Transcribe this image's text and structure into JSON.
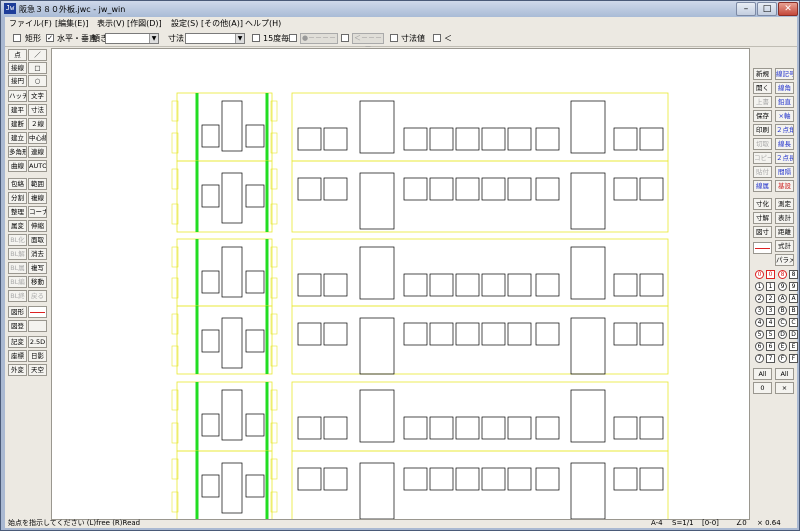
{
  "window": {
    "title": "阪急３８０外板.jwc - jw_win",
    "app_icon": "Jw"
  },
  "menu": [
    "ファイル(F)",
    "[編集(E)]",
    "表示(V)",
    "[作図(D)]",
    "設定(S)",
    "[その他(A)]",
    "ヘルプ(H)"
  ],
  "toolbar": {
    "rect_label": "矩形",
    "hv_label": "水平・垂直",
    "tilt_label": "傾き",
    "dim_label": "寸法",
    "deg15_label": "15度毎",
    "dimval_label": "寸法値",
    "gray1": "●－－－－",
    "gray2": "＜－－－－",
    "lt_label": "＜"
  },
  "left_tools": [
    [
      "点",
      "／"
    ],
    [
      "接線",
      "□"
    ],
    [
      "接円",
      "○"
    ],
    [
      "ハッチ",
      "文字"
    ],
    [
      "建平",
      "寸法"
    ],
    [
      "建断",
      "２線"
    ],
    [
      "建立",
      "中心線"
    ],
    [
      "多角形",
      "連線"
    ],
    [
      "曲線",
      "AUTO"
    ],
    [
      "包絡",
      "範囲"
    ],
    [
      "分割",
      "複線"
    ],
    [
      "整理",
      "コーナー"
    ],
    [
      "属変",
      "伸縮"
    ],
    [
      "BL化",
      "面取"
    ],
    [
      "BL解",
      "消去"
    ],
    [
      "BL属",
      "複写"
    ],
    [
      "BL編",
      "移動"
    ],
    [
      "BL終",
      "戻る"
    ],
    [
      "図形",
      ""
    ],
    [
      "図登",
      ""
    ],
    [
      "記変",
      "2.5D"
    ],
    [
      "座標",
      "日影"
    ],
    [
      "外変",
      "天空"
    ]
  ],
  "right_tools": [
    [
      "新規",
      "線記号変形"
    ],
    [
      "開く",
      "線角"
    ],
    [
      "上書",
      "鉛直"
    ],
    [
      "保存",
      "×軸"
    ],
    [
      "印刷",
      "２点角"
    ],
    [
      "切取",
      "線長"
    ],
    [
      "コピー",
      "２点長"
    ],
    [
      "貼付",
      "間隔"
    ],
    [
      "線属",
      "基設"
    ],
    [
      "寸化",
      "測定"
    ],
    [
      "寸解",
      "表計"
    ],
    [
      "図寸",
      "距離"
    ],
    [
      "",
      "式計"
    ],
    [
      "",
      "パラメ"
    ]
  ],
  "layer_buttons": [
    "0",
    "8",
    "1",
    "9",
    "2",
    "A",
    "3",
    "B",
    "4",
    "C",
    "5",
    "D",
    "6",
    "E",
    "7",
    "F"
  ],
  "layer_all": [
    "All",
    "All",
    "0",
    "×"
  ],
  "status": {
    "hint": "始点を指示してください (L)free (R)Read",
    "paper": "A-4",
    "scale": "S=1/1",
    "layer": "[0-0]",
    "angle": "∠0",
    "zoom": "× 0.64"
  }
}
